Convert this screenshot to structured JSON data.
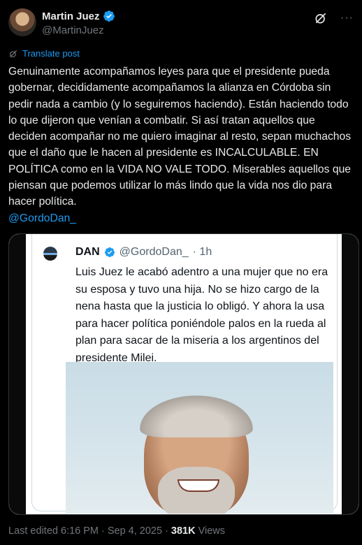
{
  "author": {
    "name": "Martin Juez",
    "handle": "@MartinJuez",
    "verified_icon": "verified-badge-icon"
  },
  "header_icons": {
    "grok": "grok-icon",
    "more": "···"
  },
  "translate": {
    "label": "Translate post"
  },
  "post": {
    "text": "Genuinamente acompañamos leyes para que el presidente pueda gobernar, decididamente acompañamos la alianza en Córdoba sin pedir nada a cambio (y lo seguiremos haciendo). Están haciendo todo lo que dijeron que venían a combatir. Si así tratan aquellos que deciden acompañar no me quiero imaginar al resto, sepan muchachos que el daño que le hacen al presidente es INCALCULABLE. EN POLÍTICA como en la VIDA NO VALE TODO. Miserables aquellos que piensan que podemos utilizar lo más lindo que la vida nos dio para hacer política.",
    "mention": "@GordoDan_"
  },
  "quoted": {
    "name": "DAN",
    "handle": "@GordoDan_",
    "time": "· 1h",
    "text": "Luis Juez le acabó adentro a una mujer que no era su esposa y tuvo una hija. No se hizo cargo de la nena hasta que la justicia lo obligó. Y ahora la usa para hacer política poniéndole palos en la rueda al plan para sacar de la miseria a los argentinos del presidente Milei."
  },
  "footer": {
    "edited": "Last edited 6:16 PM · Sep 4, 2025 ·",
    "views_count": "381K",
    "views_label": "Views"
  },
  "colors": {
    "background": "#000000",
    "text": "#e7e9ea",
    "muted": "#71767b",
    "accent": "#1d9bf0"
  }
}
